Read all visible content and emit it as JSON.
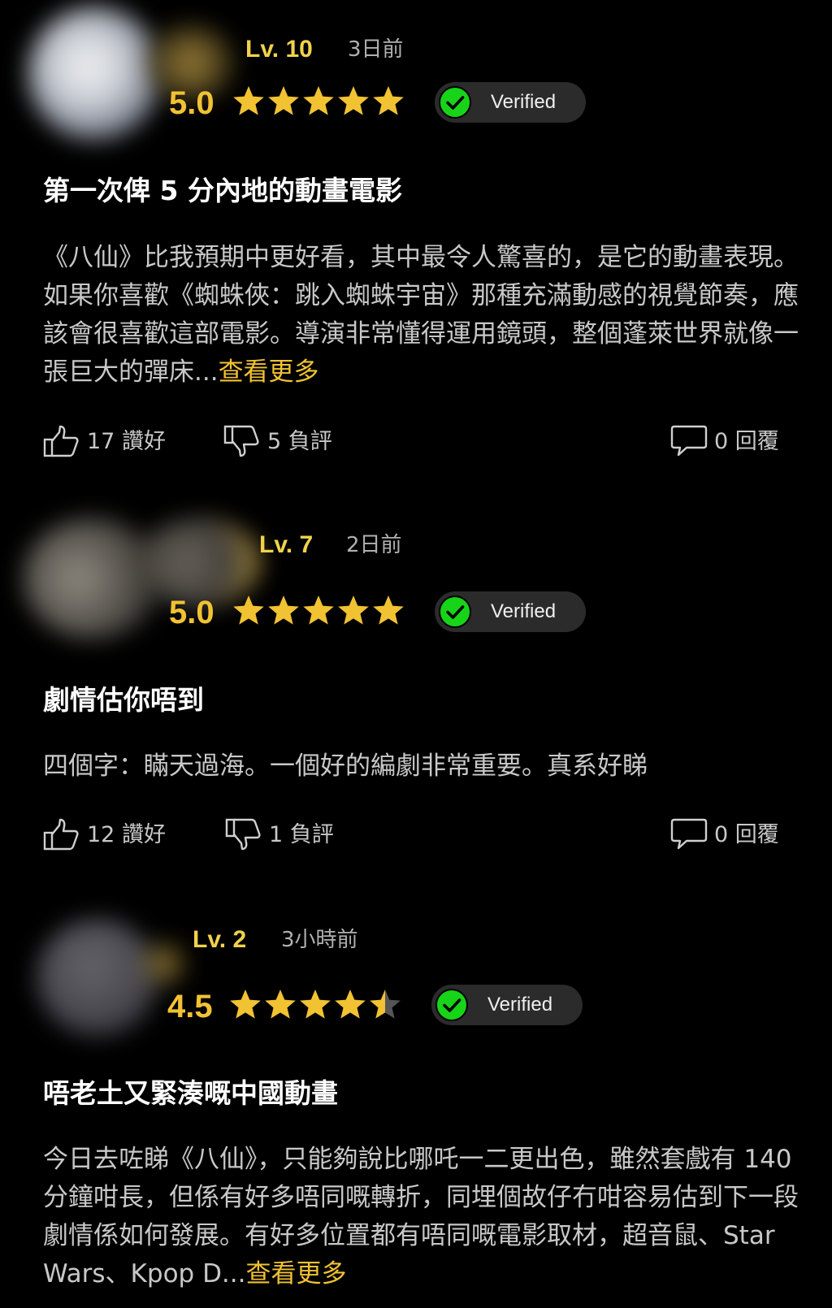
{
  "reviews": [
    {
      "level": "Lv. 10",
      "time": "3日前",
      "score": "5.0",
      "rating": 5,
      "verified_label": "Verified",
      "title": "第一次俾 5 分內地的動畫電影",
      "body": "《八仙》比我預期中更好看，其中最令人驚喜的，是它的動畫表現。如果你喜歡《蜘蛛俠：跳入蜘蛛宇宙》那種充滿動感的視覺節奏，應該會很喜歡這部電影。導演非常懂得運用鏡頭，整個蓬萊世界就像一張巨大的彈床...",
      "more_label": "查看更多",
      "likes": "17 讚好",
      "dislikes": "5 負評",
      "replies": "0 回覆"
    },
    {
      "level": "Lv. 7",
      "time": "2日前",
      "score": "5.0",
      "rating": 5,
      "verified_label": "Verified",
      "title": "劇情估你唔到",
      "body": "四個字：瞞天過海。一個好的編劇非常重要。真系好睇",
      "more_label": "",
      "likes": "12 讚好",
      "dislikes": "1 負評",
      "replies": "0 回覆"
    },
    {
      "level": "Lv. 2",
      "time": "3小時前",
      "score": "4.5",
      "rating": 4.5,
      "verified_label": "Verified",
      "title": "唔老土又緊湊嘅中國動畫",
      "body": "今日去咗睇《八仙》，只能夠說比哪吒一二更出色，雖然套戲有 140 分鐘咁長，但係有好多唔同嘅轉折，同埋個故仔冇咁容易估到下一段劇情係如何發展。有好多位置都有唔同嘅電影取材，超音鼠、Star Wars、Kpop D...",
      "more_label": "查看更多"
    }
  ],
  "colors": {
    "accent": "#f1c232",
    "level": "#f1d24c",
    "verified_green": "#18d418",
    "background": "#000000"
  },
  "icons": {
    "star": "star-icon",
    "verified": "check-circle-icon",
    "like": "thumbs-up-icon",
    "dislike": "thumbs-down-icon",
    "reply": "comment-icon"
  }
}
